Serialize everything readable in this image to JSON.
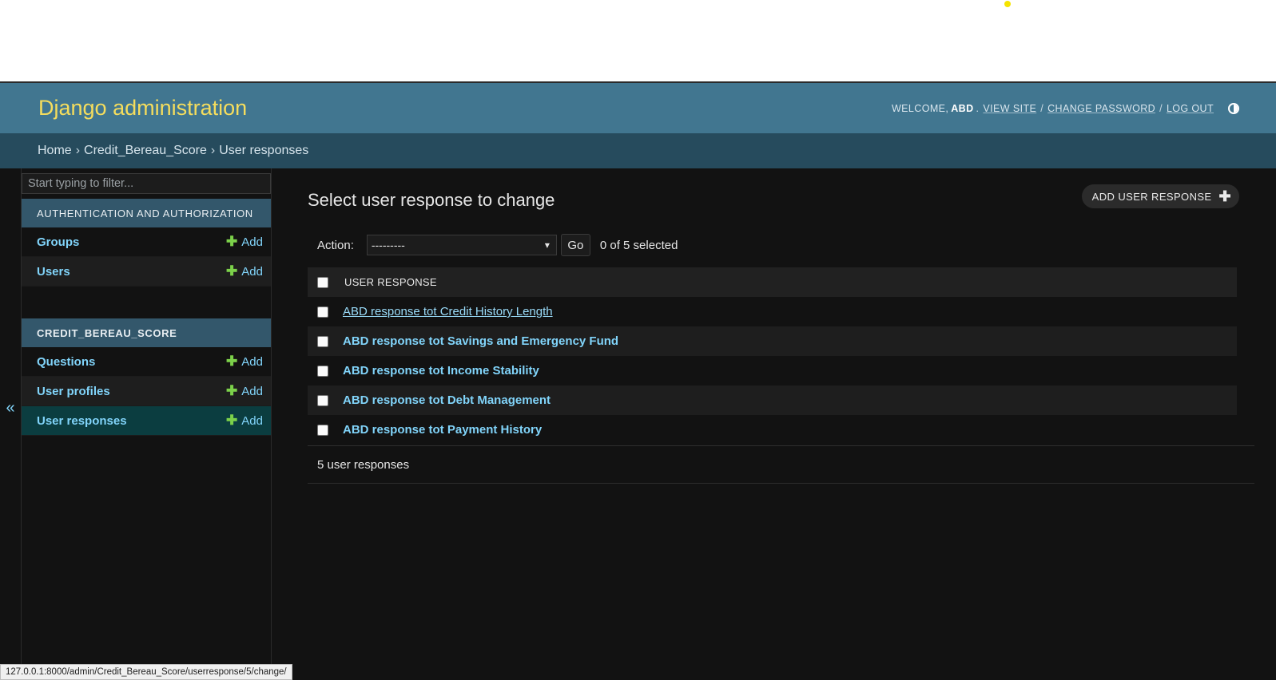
{
  "header": {
    "site_title": "Django administration",
    "welcome": "WELCOME,",
    "username": "ABD",
    "view_site": "VIEW SITE",
    "change_password": "CHANGE PASSWORD",
    "log_out": "LOG OUT",
    "separator": "/"
  },
  "breadcrumbs": [
    "Home",
    "Credit_Bereau_Score",
    "User responses"
  ],
  "breadcrumb_separator": "›",
  "sidebar": {
    "filter_placeholder": "Start typing to filter...",
    "modules": [
      {
        "caption": "AUTHENTICATION AND AUTHORIZATION",
        "models": [
          {
            "name": "Groups",
            "add": "Add"
          },
          {
            "name": "Users",
            "add": "Add"
          }
        ]
      },
      {
        "caption": "CREDIT_BEREAU_SCORE",
        "models": [
          {
            "name": "Questions",
            "add": "Add"
          },
          {
            "name": "User profiles",
            "add": "Add"
          },
          {
            "name": "User responses",
            "add": "Add"
          }
        ]
      }
    ],
    "collapse_label": "«"
  },
  "content": {
    "title": "Select user response to change",
    "add_button": "ADD USER RESPONSE",
    "action_label": "Action:",
    "action_selected": "---------",
    "go_button": "Go",
    "selected_counter": "0 of 5 selected",
    "column_header": "USER RESPONSE",
    "rows": [
      "ABD response tot Credit History Length",
      "ABD response tot Savings and Emergency Fund",
      "ABD response tot Income Stability",
      "ABD response tot Debt Management",
      "ABD response tot Payment History"
    ],
    "paginator": "5 user responses"
  },
  "status_url": "127.0.0.1:8000/admin/Credit_Bereau_Score/userresponse/5/change/",
  "colors": {
    "header_bg": "#417690",
    "brand": "#f5dd5d",
    "breadcrumbs_bg": "#264b5d",
    "link": "#81d4fa",
    "add_plus": "#7cd14a",
    "body_bg": "#121212",
    "current_row": "#0b3d40"
  }
}
